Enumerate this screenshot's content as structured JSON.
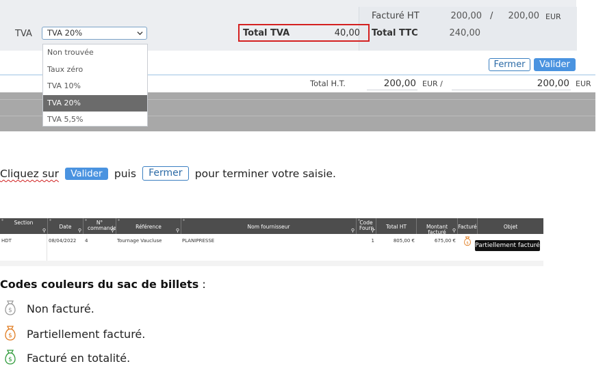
{
  "summary": {
    "facture_ht_label": "Facturé HT",
    "facture_ht_value": "200,00",
    "separator": "/",
    "facture_ht_value2": "200,00",
    "currency": "EUR",
    "total_ttc_label": "Total TTC",
    "total_ttc_value": "240,00",
    "total_tva_label": "Total TVA",
    "total_tva_value": "40,00"
  },
  "tva": {
    "label": "TVA",
    "selected": "TVA 20%",
    "options": [
      "Non trouvée",
      "Taux zéro",
      "TVA 10%",
      "TVA 20%",
      "TVA 5,5%"
    ]
  },
  "buttons": {
    "close": "Fermer",
    "validate": "Valider"
  },
  "totals_row": {
    "label": "Total H.T.",
    "value1": "200,00",
    "currency1": "EUR /",
    "value2": "200,00",
    "currency2": "EUR"
  },
  "instruction": {
    "part1": "Cliquez sur",
    "part2": "puis",
    "part3": "pour terminer votre saisie.",
    "validate": "Valider",
    "close": "Fermer"
  },
  "table": {
    "columns": [
      "Section",
      "Date",
      "N° commande",
      "Référence",
      "Nom fournisseur",
      "Code Fourn.",
      "Total HT",
      "Montant facturé",
      "Facturé",
      "Objet"
    ],
    "row": {
      "section": "HDT",
      "date": "08/04/2022",
      "commande": "4",
      "reference": "Tournage Vaucluse",
      "fournisseur": "PLANIPRESSE",
      "code": "1",
      "total_ht": "805,00 €",
      "montant": "675,00 €"
    },
    "tooltip": "Partiellement facturé"
  },
  "legend": {
    "title": "Codes couleurs du sac de billets",
    "title_suffix": " :",
    "items": [
      {
        "label": "Non facturé.",
        "color": "#9a9a9a"
      },
      {
        "label": "Partiellement facturé.",
        "color": "#e07b1f"
      },
      {
        "label": "Facturé en totalité.",
        "color": "#2e9a3a"
      }
    ]
  },
  "icons": {
    "bag": "money-bag-icon",
    "chevron": "chevron-down-icon",
    "search": "search-icon"
  }
}
